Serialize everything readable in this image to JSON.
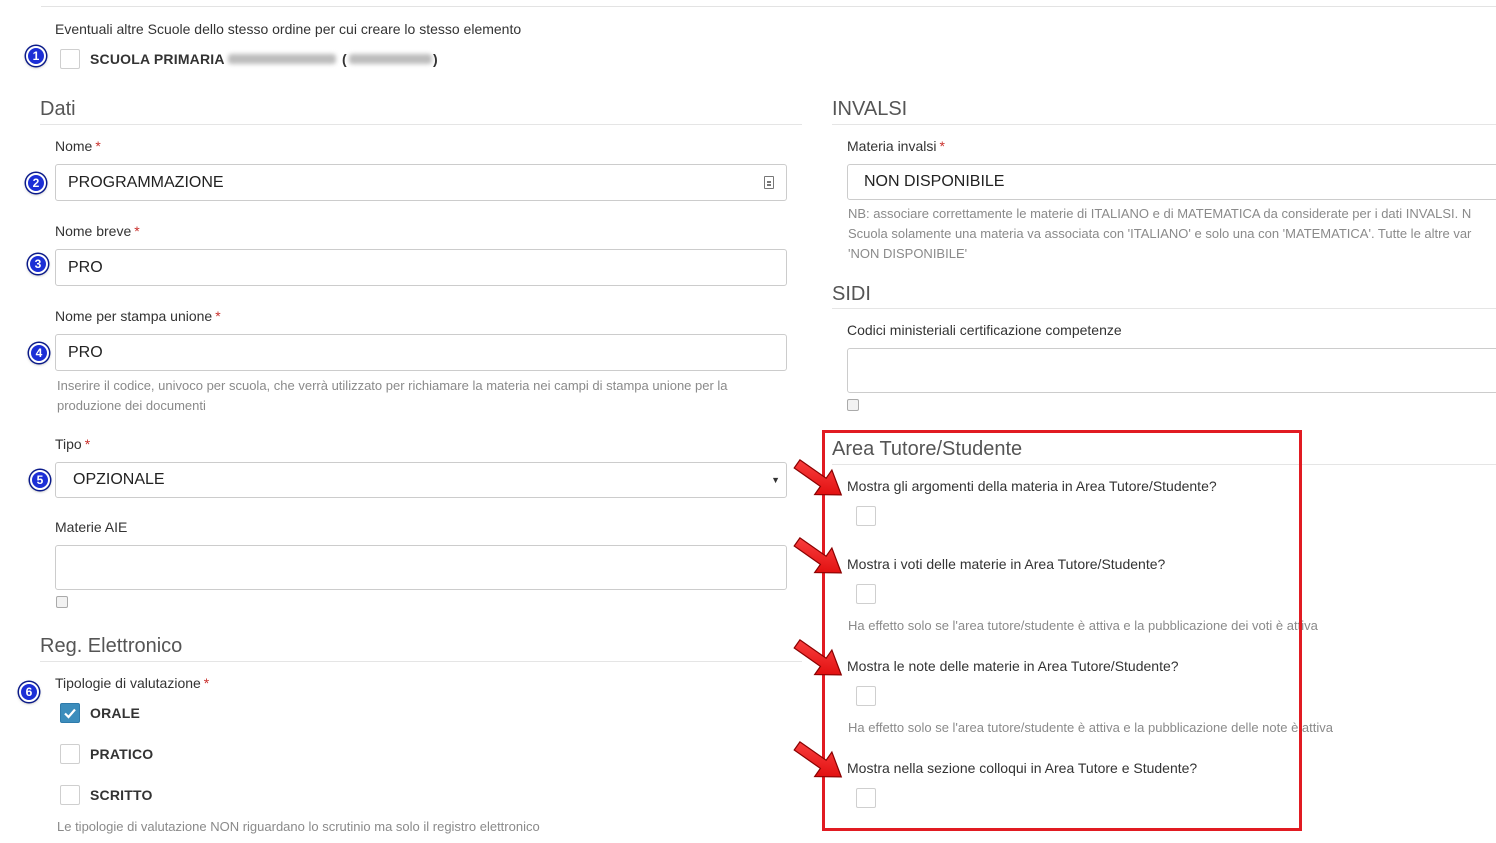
{
  "top": {
    "other_schools_label": "Eventuali altre Scuole dello stesso ordine per cui creare lo stesso elemento",
    "school_name": "SCUOLA PRIMARIA",
    "school_code_open": "(",
    "school_code_close": ")"
  },
  "badges": [
    "1",
    "2",
    "3",
    "4",
    "5",
    "6"
  ],
  "dati": {
    "section_title": "Dati",
    "nome_label": "Nome",
    "nome_value": "PROGRAMMAZIONE",
    "nome_breve_label": "Nome breve",
    "nome_breve_value": "PRO",
    "stampa_label": "Nome per stampa unione",
    "stampa_value": "PRO",
    "stampa_help": "Inserire il codice, univoco per scuola, che verrà utilizzato per richiamare la materia nei campi di stampa unione per la produzione dei documenti",
    "tipo_label": "Tipo",
    "tipo_value": "OPZIONALE",
    "materie_aie_label": "Materie AIE",
    "required_mark": "*"
  },
  "reg": {
    "section_title": "Reg. Elettronico",
    "tipologie_label": "Tipologie di valutazione",
    "options": [
      {
        "label": "ORALE",
        "checked": true
      },
      {
        "label": "PRATICO",
        "checked": false
      },
      {
        "label": "SCRITTO",
        "checked": false
      }
    ],
    "help": "Le tipologie di valutazione NON riguardano lo scrutinio ma solo il registro elettronico"
  },
  "invalsi": {
    "section_title": "INVALSI",
    "materia_label": "Materia invalsi",
    "materia_value": "NON DISPONIBILE",
    "help_line1": "NB: associare correttamente le materie di ITALIANO e di MATEMATICA da considerate per i dati INVALSI. N",
    "help_line2": "Scuola solamente una materia va associata con 'ITALIANO' e solo una con 'MATEMATICA'. Tutte le altre var",
    "help_line3": "'NON DISPONIBILE'"
  },
  "sidi": {
    "section_title": "SIDI",
    "codici_label": "Codici ministeriali certificazione competenze"
  },
  "area": {
    "section_title": "Area Tutore/Studente",
    "q1": "Mostra gli argomenti della materia in Area Tutore/Studente?",
    "q2": "Mostra i voti delle materie in Area Tutore/Studente?",
    "q2_help": "Ha effetto solo se l'area tutore/studente è attiva e la pubblicazione dei voti è attiva",
    "q3": "Mostra le note delle materie in Area Tutore/Studente?",
    "q3_help": "Ha effetto solo se l'area tutore/studente è attiva e la pubblicazione delle note è attiva",
    "q4": "Mostra nella sezione colloqui in Area Tutore e Studente?"
  },
  "colors": {
    "annotation_red": "#e11b22",
    "badge_blue": "#1c2fd6",
    "checkbox_checked": "#3c8dbc",
    "required_red": "#c9302c"
  }
}
